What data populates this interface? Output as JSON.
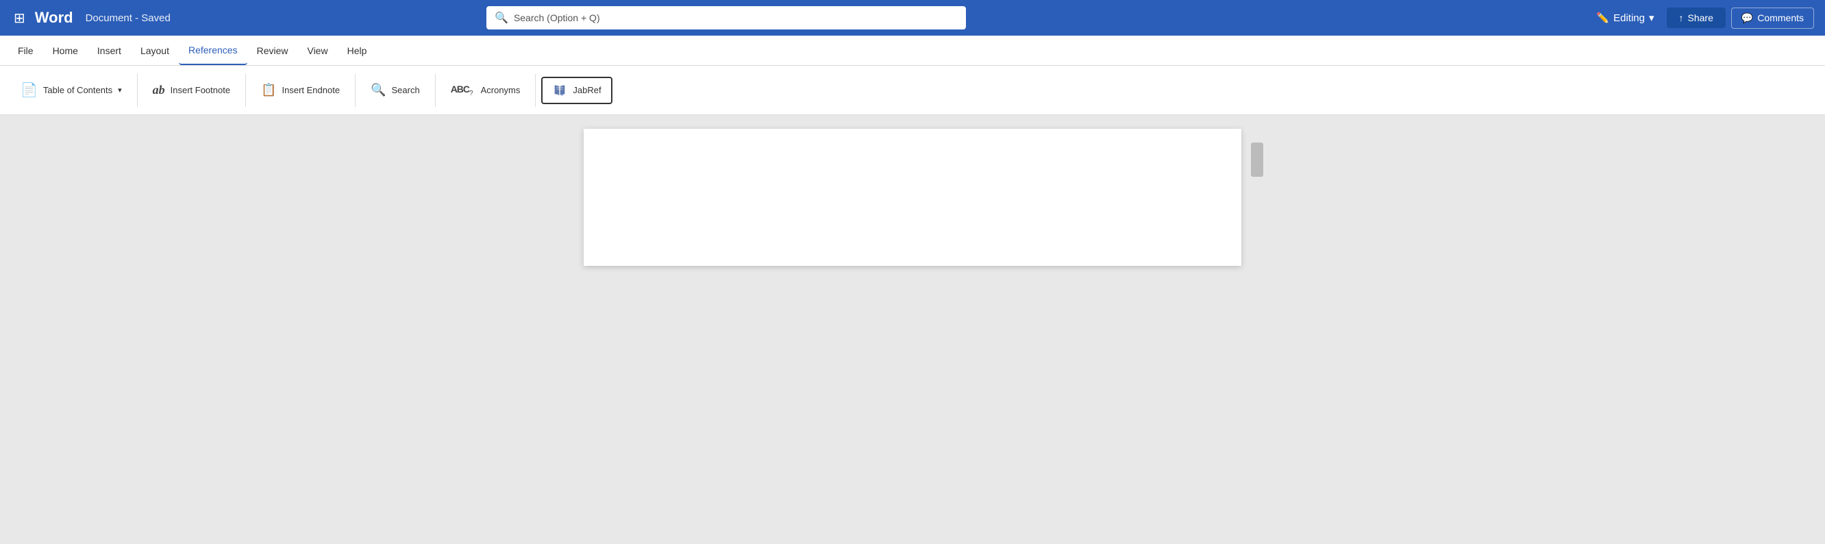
{
  "title_bar": {
    "app_name": "Word",
    "doc_title": "Document - Saved",
    "search_placeholder": "Search (Option + Q)",
    "editing_label": "Editing",
    "editing_chevron": "▾",
    "share_label": "Share",
    "comments_label": "Comments"
  },
  "menu_bar": {
    "items": [
      {
        "id": "file",
        "label": "File"
      },
      {
        "id": "home",
        "label": "Home"
      },
      {
        "id": "insert",
        "label": "Insert"
      },
      {
        "id": "layout",
        "label": "Layout"
      },
      {
        "id": "references",
        "label": "References",
        "active": true
      },
      {
        "id": "review",
        "label": "Review"
      },
      {
        "id": "view",
        "label": "View"
      },
      {
        "id": "help",
        "label": "Help"
      }
    ]
  },
  "ribbon": {
    "items": [
      {
        "id": "table-of-contents",
        "label": "Table of Contents",
        "icon": "📄",
        "has_dropdown": true
      },
      {
        "id": "insert-footnote",
        "label": "Insert Footnote",
        "icon": "ab"
      },
      {
        "id": "insert-endnote",
        "label": "Insert Endnote",
        "icon": "📋"
      },
      {
        "id": "search",
        "label": "Search",
        "icon": "🔍"
      },
      {
        "id": "acronyms",
        "label": "Acronyms",
        "icon": "ABC?"
      },
      {
        "id": "jabref",
        "label": "JabRef",
        "icon": "jabref"
      }
    ]
  },
  "colors": {
    "title_bar_bg": "#2b5eb8",
    "active_menu_color": "#2b5eb8",
    "share_btn_bg": "#1a4fa0",
    "jabref_border": "#333333"
  }
}
